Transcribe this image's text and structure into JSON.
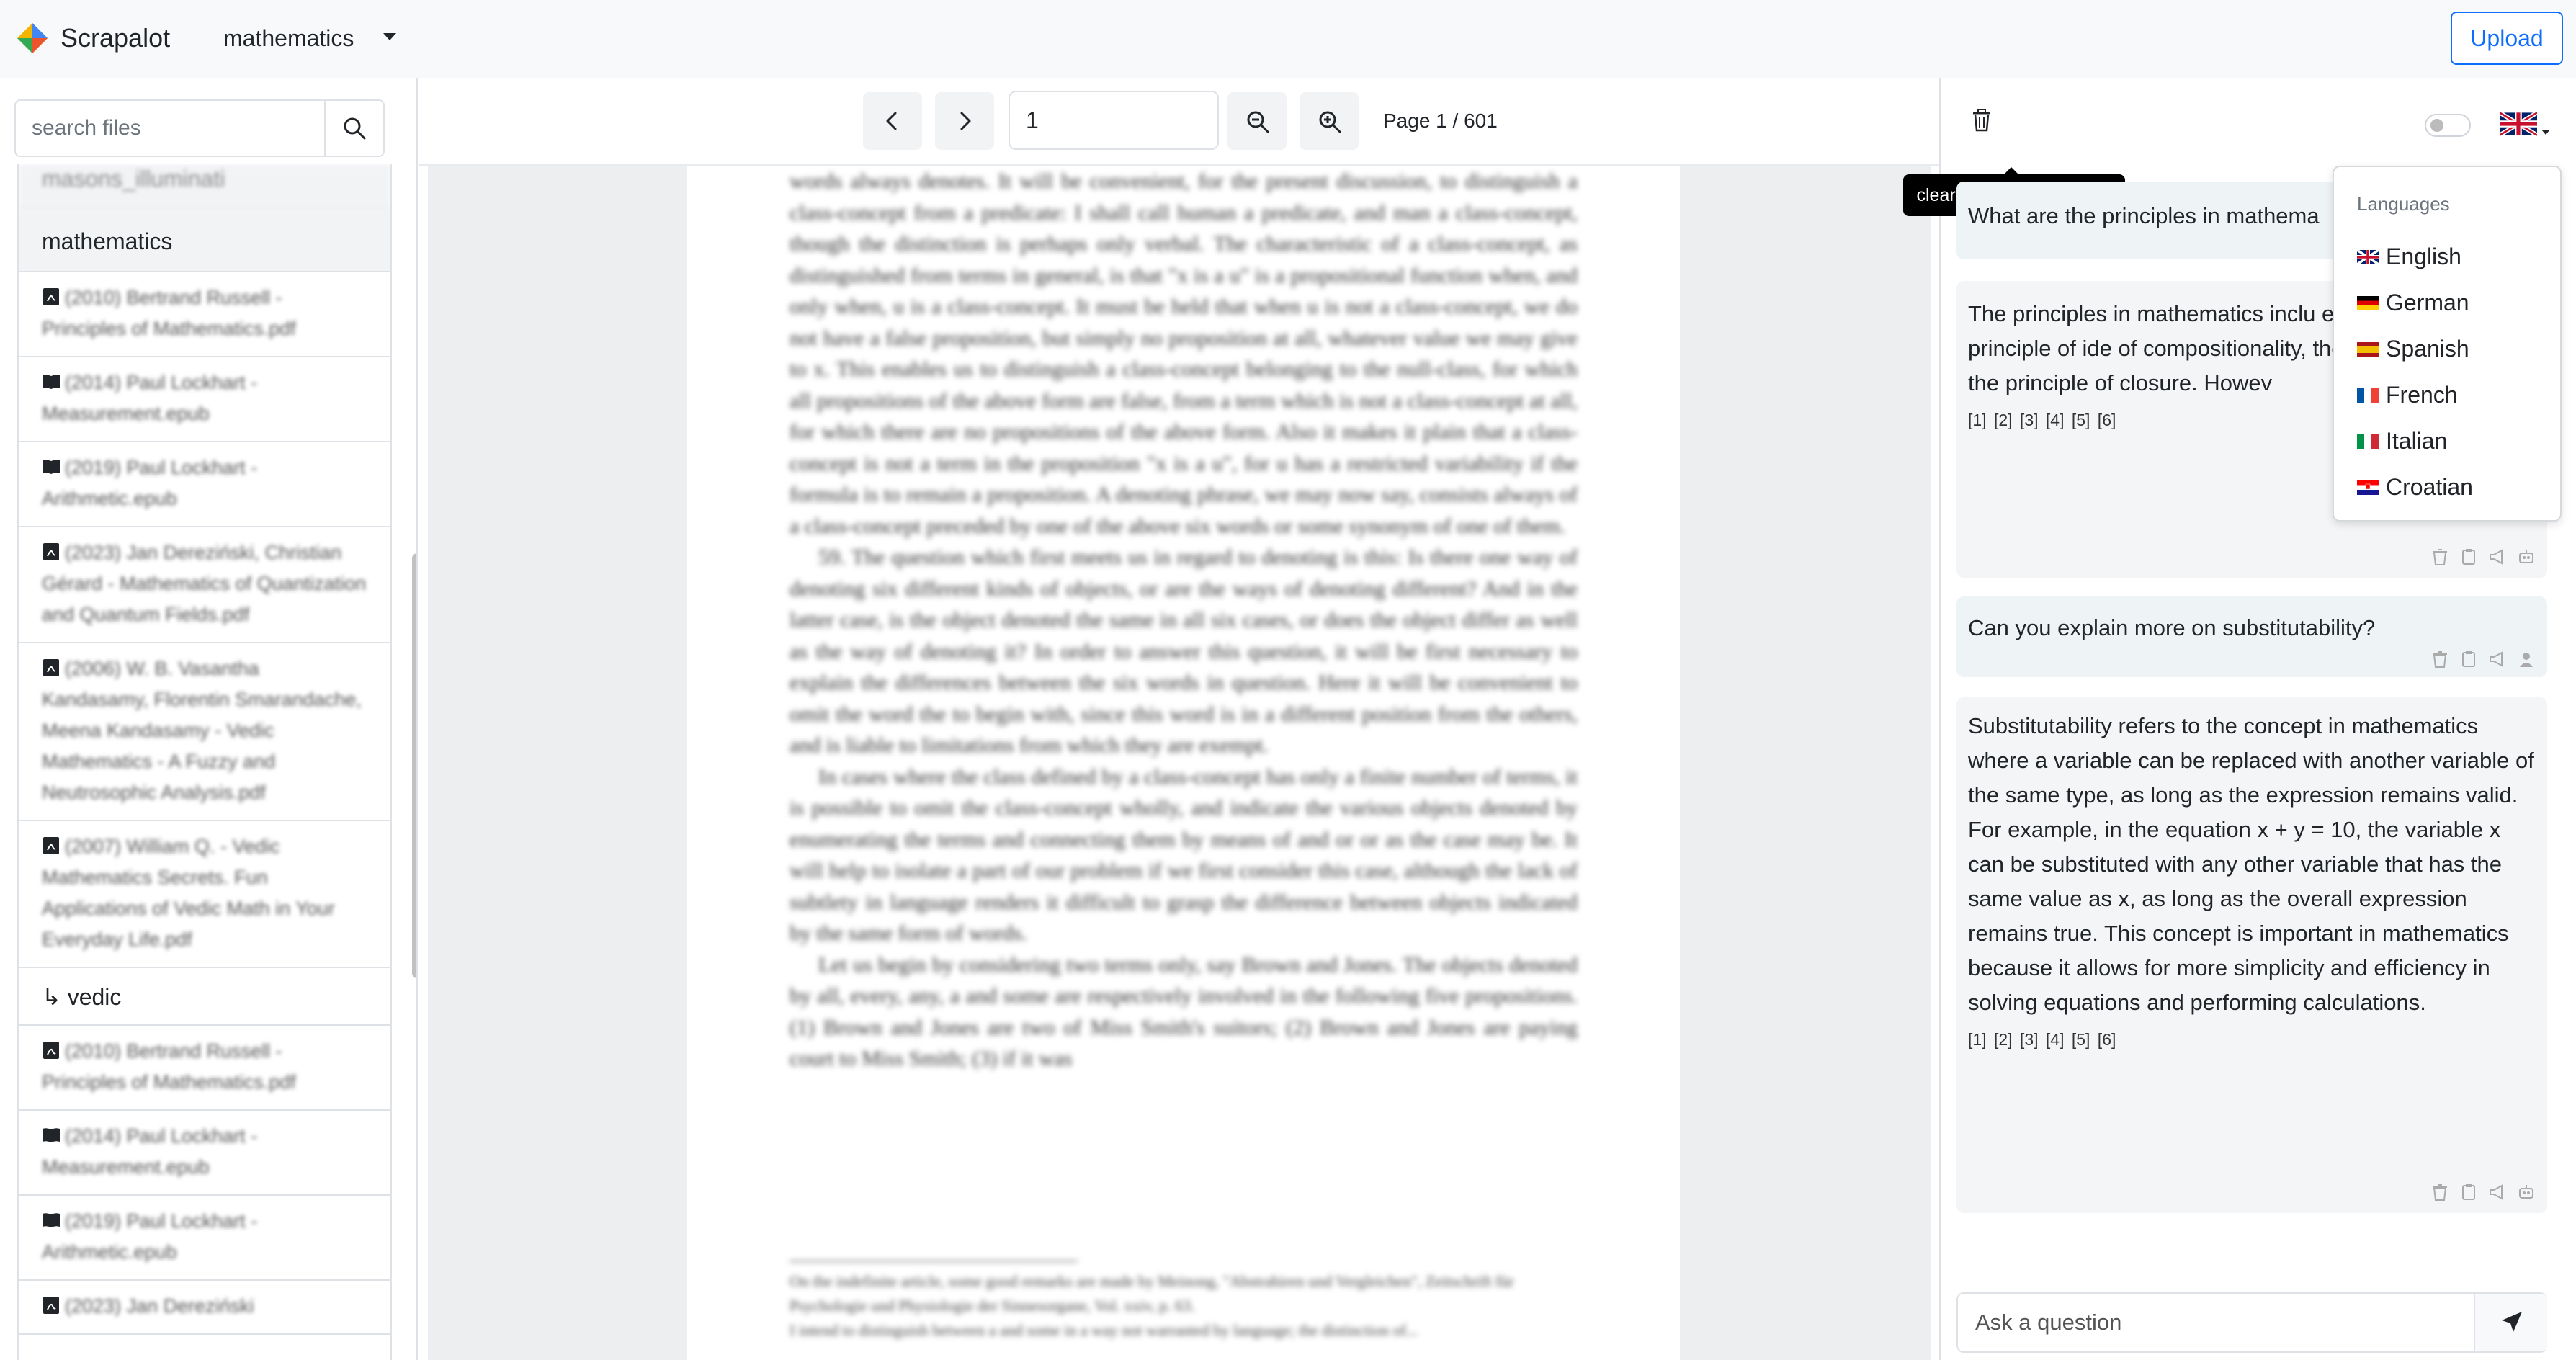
{
  "app": {
    "brand": "Scrapalot",
    "collection": "mathematics"
  },
  "header": {
    "upload_label": "Upload"
  },
  "sidebar": {
    "search_placeholder": "search files",
    "cut_group": "masons_illuminati",
    "group_name": "mathematics",
    "files": [
      {
        "icon": "pdf-file-icon",
        "name": "(2010) Bertrand Russell - Principles of Mathematics.pdf"
      },
      {
        "icon": "book-icon",
        "name": "(2014) Paul Lockhart - Measurement.epub"
      },
      {
        "icon": "book-icon",
        "name": "(2019) Paul Lockhart - Arithmetic.epub"
      },
      {
        "icon": "pdf-file-icon",
        "name": "(2023) Jan Dereziński, Christian Gérard - Mathematics of Quantization and Quantum Fields.pdf"
      },
      {
        "icon": "pdf-file-icon",
        "name": "(2006) W. B. Vasantha Kandasamy, Florentin Smarandache, Meena Kandasamy - Vedic Mathematics - A Fuzzy and Neutrosophic Analysis.pdf"
      },
      {
        "icon": "pdf-file-icon",
        "name": "(2007) William Q. - Vedic Mathematics Secrets. Fun Applications of Vedic Math in Your Everyday Life.pdf"
      }
    ],
    "subgroup_name": "↳ vedic",
    "sub_files": [
      {
        "icon": "pdf-file-icon",
        "name": "(2010) Bertrand Russell - Principles of Mathematics.pdf"
      },
      {
        "icon": "book-icon",
        "name": "(2014) Paul Lockhart - Measurement.epub"
      },
      {
        "icon": "book-icon",
        "name": "(2019) Paul Lockhart - Arithmetic.epub"
      },
      {
        "icon": "pdf-file-icon",
        "name": "(2023) Jan Dereziński"
      }
    ]
  },
  "viewer": {
    "page_value": "1",
    "page_info": "Page 1 / 601",
    "body_paragraphs": [
      "words always denotes. It will be convenient, for the present discussion, to distinguish a class-concept from a predicate: I shall call human a predicate, and man a class-concept, though the distinction is perhaps only verbal. The characteristic of a class-concept, as distinguished from terms in general, is that \"x is a u\" is a propositional function when, and only when, u is a class-concept. It must be held that when u is not a class-concept, we do not have a false proposition, but simply no proposition at all, whatever value we may give to x. This enables us to distinguish a class-concept belonging to the null-class, for which all propositions of the above form are false, from a term which is not a class-concept at all, for which there are no propositions of the above form. Also it makes it plain that a class-concept is not a term in the proposition \"x is a u\", for u has a restricted variability if the formula is to remain a proposition. A denoting phrase, we may now say, consists always of a class-concept preceded by one of the above six words or some synonym of one of them.",
      "59. The question which first meets us in regard to denoting is this: Is there one way of denoting six different kinds of objects, or are the ways of denoting different? And in the latter case, is the object denoted the same in all six cases, or does the object differ as well as the way of denoting it? In order to answer this question, it will be first necessary to explain the differences between the six words in question. Here it will be convenient to omit the word the to begin with, since this word is in a different position from the others, and is liable to limitations from which they are exempt.",
      "In cases where the class defined by a class-concept has only a finite number of terms, it is possible to omit the class-concept wholly, and indicate the various objects denoted by enumerating the terms and connecting them by means of and or or as the case may be. It will help to isolate a part of our problem if we first consider this case, although the lack of subtlety in language renders it difficult to grasp the difference between objects indicated by the same form of words.",
      "Let us begin by considering two terms only, say Brown and Jones. The objects denoted by all, every, any, a and some are respectively involved in the following five propositions. (1) Brown and Jones are two of Miss Smith's suitors; (2) Brown and Jones are paying court to Miss Smith; (3) if it was"
    ],
    "footnotes": [
      "On the indefinite article, some good remarks are made by Meinong, \"Abstrahiren und Vergleichen\", Zeitschrift für Psychologie und Physiologie der Sinnesorgane, Vol. xxiv, p. 63.",
      "I intend to distinguish between a and some in a way not warranted by language; the distinction of..."
    ]
  },
  "chat": {
    "tooltip": "clear the chat messages",
    "input_placeholder": "Ask a question",
    "messages": [
      {
        "role": "user",
        "text": "What are the principles in mathema"
      },
      {
        "role": "assistant",
        "text": "The principles in mathematics inclu excluded middle, the principle of ide of compositionality, the principle of and the principle of closure. Howev",
        "refs": "[1] [2] [3] [4] [5] [6]"
      },
      {
        "role": "user",
        "text": "Can you explain more on substitutability?"
      },
      {
        "role": "assistant",
        "text": "Substitutability refers to the concept in mathematics where a variable can be replaced with another variable of the same type, as long as the expression remains valid. For example, in the equation x + y = 10, the variable x can be substituted with any other variable that has the same value as x, as long as the overall expression remains true. This concept is important in mathematics because it allows for more simplicity and efficiency in solving equations and performing calculations.",
        "refs": "[1] [2] [3] [4] [5] [6]"
      }
    ]
  },
  "languages": {
    "header": "Languages",
    "items": [
      "English",
      "German",
      "Spanish",
      "French",
      "Italian",
      "Croatian"
    ]
  },
  "colors": {
    "accent": "#0d6efd",
    "tooltip_bg": "#000000",
    "user_bubble": "#eef4f6",
    "assistant_bubble": "#f4f5f7"
  }
}
